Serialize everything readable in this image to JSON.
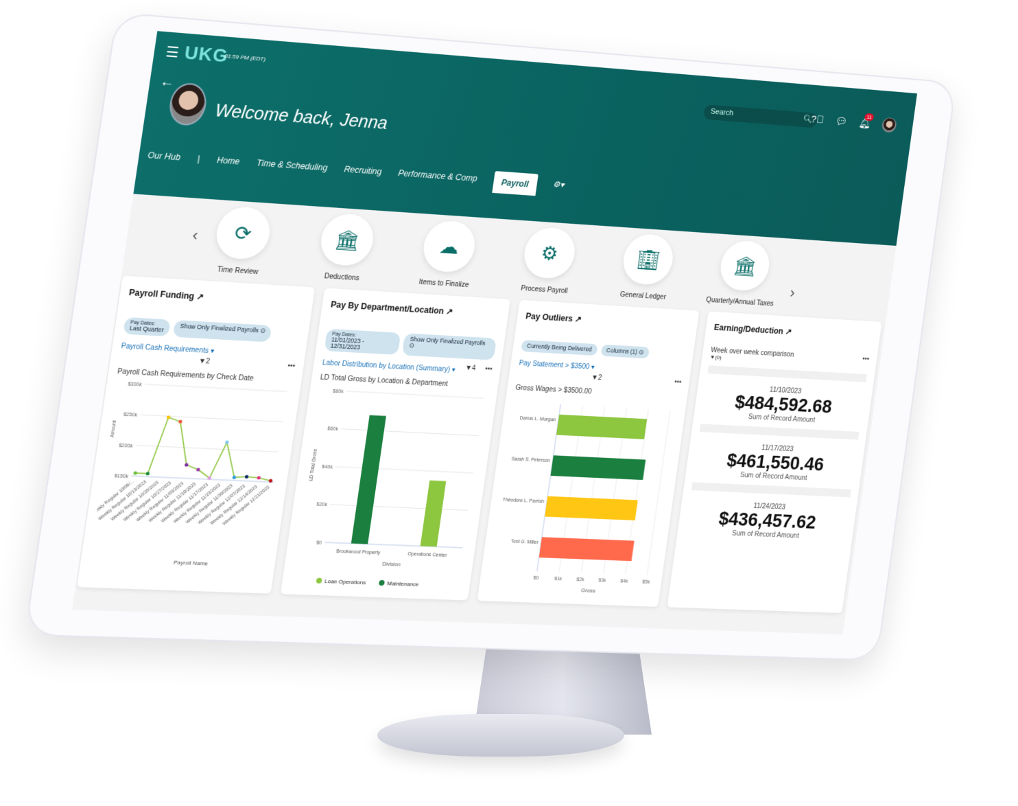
{
  "header": {
    "logo": "UKG",
    "time": "01:59 PM (EDT)",
    "welcome": "Welcome back, Jenna",
    "search_placeholder": "Search",
    "notif_count": "11",
    "tabs": [
      {
        "label": "Our Hub"
      },
      {
        "label": "|"
      },
      {
        "label": "Home"
      },
      {
        "label": "Time & Scheduling"
      },
      {
        "label": "Recruiting"
      },
      {
        "label": "Performance & Comp"
      },
      {
        "label": "Payroll",
        "active": true
      }
    ],
    "gear": "⚙▾"
  },
  "carousel": [
    {
      "label": "Time Review",
      "icon": "clock-cycle-icon"
    },
    {
      "label": "Deductions",
      "icon": "bank-dollar-icon"
    },
    {
      "label": "Items to Finalize",
      "icon": "cloud-gear-icon"
    },
    {
      "label": "Process Payroll",
      "icon": "person-gear-icon"
    },
    {
      "label": "General Ledger",
      "icon": "building-icon"
    },
    {
      "label": "Quarterly/Annual Taxes",
      "icon": "bank-dollar-icon"
    }
  ],
  "cards": {
    "funding": {
      "title": "Payroll Funding ↗",
      "chip1_small": "Pay Dates:",
      "chip1": "Last Quarter",
      "chip2": "Show Only Finalized Payrolls ⊙",
      "link": "Payroll Cash Requirements ▾",
      "filter": "▼2",
      "more": "•••",
      "subtitle": "Payroll Cash Requirements by Check Date"
    },
    "dept": {
      "title": "Pay By Department/Location ↗",
      "chip1_small": "Pay Dates:",
      "chip1": "11/01/2023 - 12/31/2023",
      "chip2": "Show Only Finalized Payrolls ⊙",
      "link": "Labor Distribution by Location (Summary) ▾",
      "filter": "▼4",
      "more": "•••",
      "subtitle": "LD Total Gross by Location & Department"
    },
    "outliers": {
      "title": "Pay Outliers ↗",
      "chip1": "Currently Being Delivered",
      "chip2": "Columns (1) ⊙",
      "link": "Pay Statement > $3500 ▾",
      "filter": "▼2",
      "more": "•••",
      "subtitle": "Gross Wages > $3500.00"
    },
    "earning": {
      "title": "Earning/Deduction ↗",
      "subtitle": "Week over week comparison",
      "filter": "▼(0)",
      "more": "•••",
      "items": [
        {
          "date": "11/10/2023",
          "amount": "$484,592.68",
          "label": "Sum of Record Amount"
        },
        {
          "date": "11/17/2023",
          "amount": "$461,550.46",
          "label": "Sum of Record Amount"
        },
        {
          "date": "11/24/2023",
          "amount": "$436,457.62",
          "label": "Sum of Record Amount"
        }
      ]
    }
  },
  "chart_data": [
    {
      "type": "line",
      "xlabel": "Payroll Name",
      "ylabel": "Amount",
      "ylim": [
        150000,
        300000
      ],
      "yticks": [
        "$150k",
        "$200k",
        "$250k",
        "$300k"
      ],
      "categories": [
        "Weekly Regular 10/06/...",
        "Weekly Regular 10/13/2023",
        "Weekly Regular 10/20/2023",
        "Weekly Regular 10/27/2023",
        "Weekly Regular 11/03/2023",
        "Weekly Regular 11/10/2023",
        "Weekly Regular 11/17/2023",
        "Weekly Regular 11/23/2023",
        "Weekly Regular 11/30/2023",
        "Weekly Regular 12/07/2023",
        "Weekly Regular 12/14/2023",
        "Weekly Regular 12/21/2023"
      ],
      "values": [
        155000,
        155000,
        248000,
        242000,
        172000,
        165000,
        152000,
        212000,
        155000,
        157000,
        156000,
        152000
      ],
      "line_color": "#8dc63f",
      "point_colors": [
        "#6abf3c",
        "#1b8a3a",
        "#f5c400",
        "#f0553a",
        "#7b2f9e",
        "#9c3fa8",
        "#e39be0",
        "#7fc8f0",
        "#2e9ae0",
        "#0d2a6b",
        "#e0357a",
        "#c0101a"
      ]
    },
    {
      "type": "bar",
      "xlabel": "Division",
      "ylabel": "LD Total Gross",
      "ylim": [
        0,
        80000
      ],
      "yticks": [
        "$0",
        "$20k",
        "$40k",
        "$60k",
        "$80k"
      ],
      "categories": [
        "Brookwood Property",
        "Operations Center"
      ],
      "series": [
        {
          "name": "Maintenance",
          "color": "#1b7f3f",
          "values": [
            68000,
            0
          ]
        },
        {
          "name": "Loan Operations",
          "color": "#8dc63f",
          "values": [
            0,
            35000
          ]
        }
      ],
      "legend": "bottom"
    },
    {
      "type": "bar",
      "orientation": "horizontal",
      "xlabel": "Gross",
      "xlim": [
        0,
        5000
      ],
      "xticks": [
        "$0",
        "$1k",
        "$2k",
        "$3k",
        "$4k",
        "$5k"
      ],
      "categories": [
        "Darius L. Morgan",
        "Sarah S. Peterson",
        "Theodore L. Parrish",
        "Toni G. Miller"
      ],
      "values": [
        4000,
        4200,
        4100,
        4200
      ],
      "colors": [
        "#8dc63f",
        "#1b7f3f",
        "#ffc614",
        "#ff6a4d"
      ]
    }
  ]
}
